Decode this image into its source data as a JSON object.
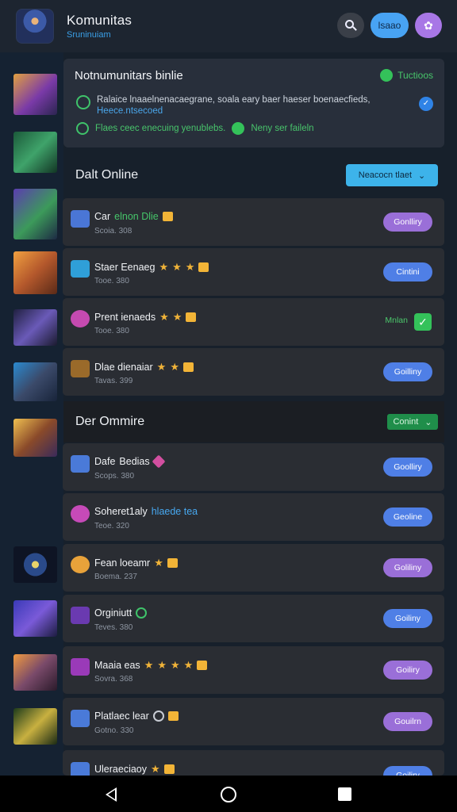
{
  "header": {
    "app_title": "Komunitas",
    "app_subtitle": "Sruninuiam",
    "pill_label": "lsaao",
    "profile_glyph": "✿"
  },
  "notice": {
    "title": "Notnumunitars binlie",
    "badge": "Tuctioos",
    "line1": "Ralaice lnaaelnenacaegrane, soala eary baer haeser boenaecfieds,",
    "line1_link": "Heece.ntsecoed",
    "line2": "Flaes ceec enecuing yenublebs.",
    "line2_suffix": "Neny  ser faileln"
  },
  "section1": {
    "label": "Dalt Online",
    "dropdown": "Neacocn tlaet"
  },
  "section2": {
    "label": "Der Ommire",
    "dropdown": "Conint"
  },
  "cards1": [
    {
      "name": "Car",
      "tag": "elnon Dlie",
      "meta": "Scoia. 308",
      "button": "Gonlliry"
    },
    {
      "name": "Staer Eenaeg",
      "meta": "Tooe. 380",
      "button": "Cintini"
    },
    {
      "name": "Prent ienaeds",
      "meta": "Tooe. 380",
      "status": "Mnlan"
    },
    {
      "name": "Dlae dienaiar",
      "meta": "Tavas. 399",
      "button": "Goilliny"
    }
  ],
  "cards2": [
    {
      "name": "Dafe",
      "tag": "Bedias",
      "meta": "Scops. 380",
      "button": "Goolliry"
    },
    {
      "name": "Soheret1aly",
      "tag": "hlaede tea",
      "meta": "Teoe. 320",
      "button": "Geoline"
    },
    {
      "name": "Fean loeamr",
      "meta": "Boema. 237",
      "button": "Goliliny"
    },
    {
      "name": "Orginiutt",
      "meta": "Teves. 380",
      "button": "Goiliny"
    },
    {
      "name": "Maaia eas",
      "meta": "Sovra. 368",
      "button": "Goiliry"
    },
    {
      "name": "Platlaec lear",
      "meta": "Gotno. 330",
      "button": "Gouilrn"
    },
    {
      "name": "Uleraeciaoy",
      "meta": "",
      "button": "Goiliry"
    }
  ],
  "nav": {
    "back": "back",
    "home": "home",
    "recent": "recent"
  }
}
